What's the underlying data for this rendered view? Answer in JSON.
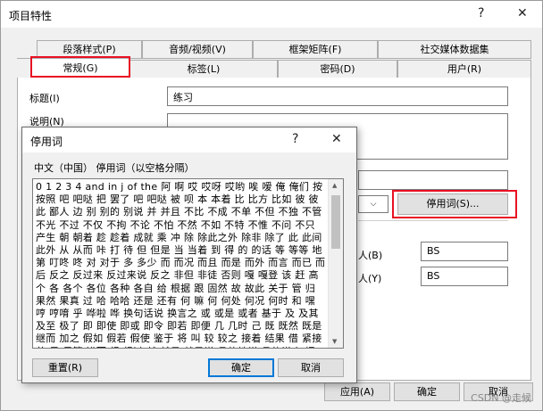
{
  "main_window": {
    "title": "项目特性",
    "help_btn": "?",
    "close_btn": "✕",
    "tabs_row1": [
      "段落样式(P)",
      "音频/视频(V)",
      "框架矩阵(F)",
      "社交媒体数据集"
    ],
    "tabs_row2": [
      "常规(G)",
      "标签(L)",
      "密码(D)",
      "用户(R)"
    ],
    "active_tab": "常规(G)",
    "fields": {
      "title_label": "标题(I)",
      "title_value": "练习",
      "desc_label": "说明(N)",
      "row_label_b": "人(B)",
      "row_value_b": "BS",
      "row_label_y": "人(Y)",
      "row_value_y": "BS"
    },
    "stopwords_button": "停用词(S)...",
    "footer_buttons": {
      "apply": "应用(A)",
      "ok": "确定",
      "cancel": "取消"
    },
    "watermark": "CSDN @走候"
  },
  "dialog": {
    "title": "停用词",
    "help_btn": "?",
    "close_btn": "✕",
    "header": "中文（中国）   停用词（以空格分隔）",
    "stopwords_text": "0 1 2 3 4 and in j of the 阿 啊 哎 哎呀 哎哟 唉 嗳 俺 俺们 按 按照 吧 吧哒 把 罢了 吧 吧哒 被 呗 本 本着 比 比方 比如 彼 彼此 鄙人 边 别 别的 别说 并 并且 不比 不成 不单 不但 不独 不管 不光 不过 不仅 不拘 不论 不怕 不然 不如 不特 不惟 不问 不只 产生 朝 朝着 趁 趁着 成就 乘 冲 除 除此之外 除非 除了 此 此间 此外 从 从而 咔 打 待 但 但是 当 当着 到 得 的 的话 等 等等 地 第 叮咚 咚 对 对于 多 多少 而 而况 而且 而是 而外 而言 而已 而后 反之 反过来 反过来说 反之 非但 非徒 否则 嘎 嘎登 该 赶 高 个 各 各个 各位 各种 各自 给 根据 跟 固然 故 故此 关于 管 归 果然 果真 过 哈 哈哈 还是 还有 何 嘛 何 何处 何况 何时 和 嘿 哼 哼唷 乎 哗啦 哗 换句话说 换言之 或 或是 或者 基于 及 及其 及至 极了 即 即使 即或 即令 即若 即便 几 几时 己 既 既然 既是 继而 加之 假如 假若 假使 鉴于 将 叫 较 较之 接着 结果 借 紧接着 尽 尽管 进而 经 经过 就 就是 就是说 具体地说 具体说来 据 开始 开外 靠",
    "reset_button": "重置(R)",
    "ok_button": "确定",
    "cancel_button": "取消"
  },
  "colors": {
    "highlight_red": "#e81123",
    "focus_blue": "#0078d7",
    "window_bg": "#f0f0f0"
  }
}
